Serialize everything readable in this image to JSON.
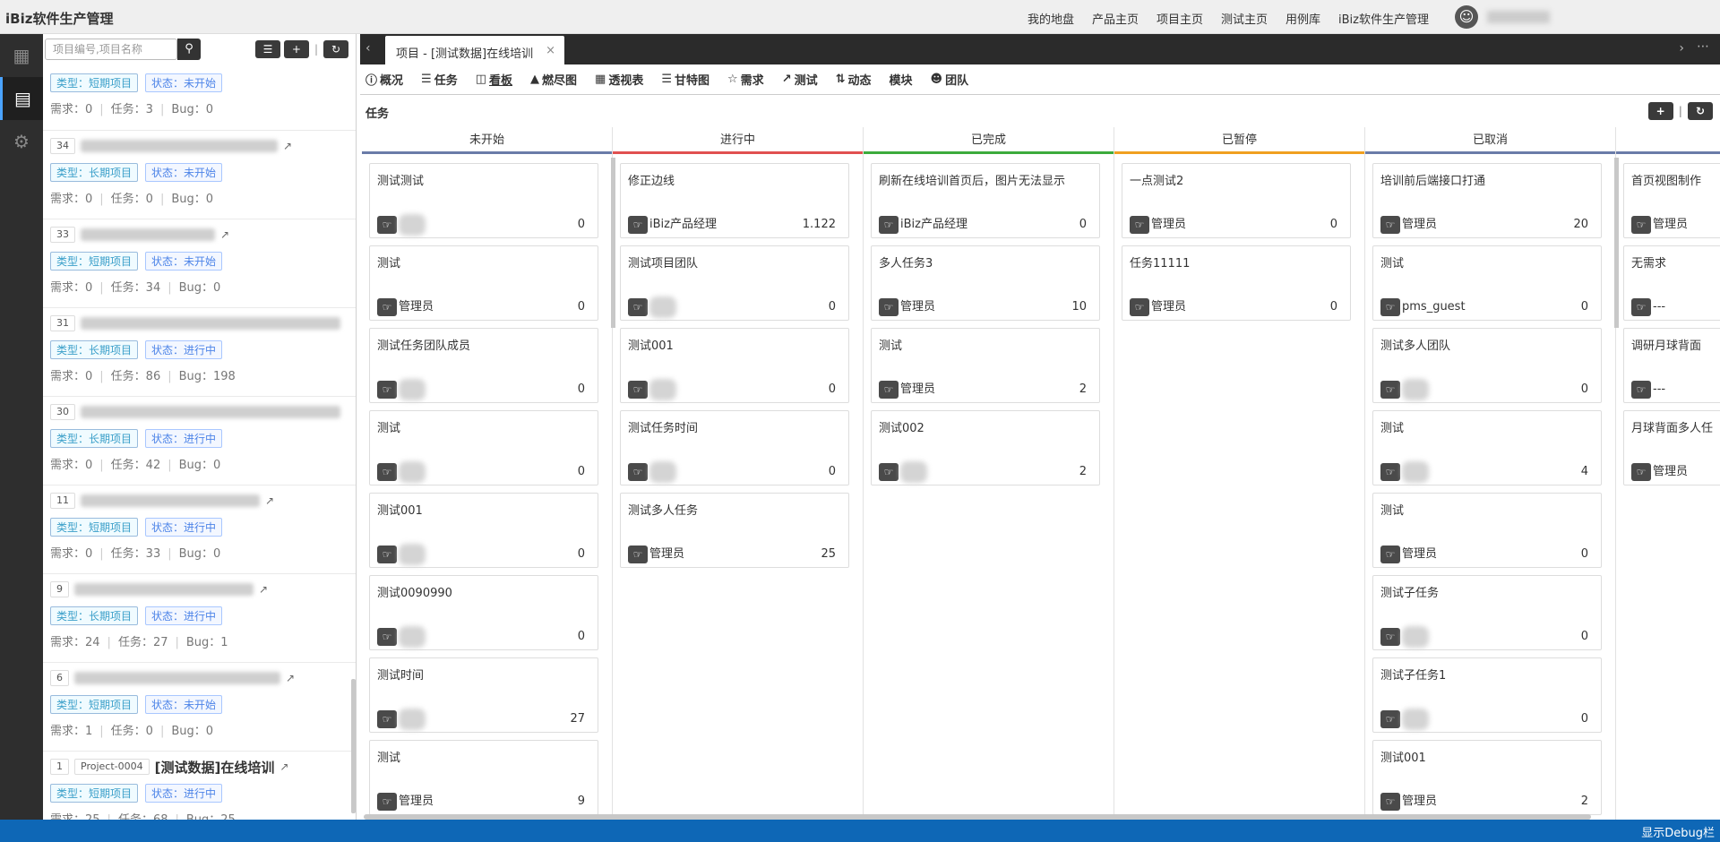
{
  "app": {
    "title": "iBiz软件生产管理"
  },
  "topnav": [
    "我的地盘",
    "产品主页",
    "项目主页",
    "测试主页",
    "用例库",
    "iBiz软件生产管理"
  ],
  "search": {
    "placeholder": "项目编号,项目名称"
  },
  "projects": [
    {
      "num": "",
      "type": "类型：短期项目",
      "status": "状态：未开始",
      "req": "需求：0",
      "task": "任务：3",
      "bug": "Bug：0"
    },
    {
      "num": "34",
      "type": "类型：长期项目",
      "status": "状态：未开始",
      "req": "需求：0",
      "task": "任务：0",
      "bug": "Bug：0"
    },
    {
      "num": "33",
      "type": "类型：短期项目",
      "status": "状态：未开始",
      "req": "需求：0",
      "task": "任务：34",
      "bug": "Bug：0"
    },
    {
      "num": "31",
      "type": "类型：长期项目",
      "status": "状态：进行中",
      "req": "需求：0",
      "task": "任务：86",
      "bug": "Bug：198"
    },
    {
      "num": "30",
      "type": "类型：长期项目",
      "status": "状态：进行中",
      "req": "需求：0",
      "task": "任务：42",
      "bug": "Bug：0"
    },
    {
      "num": "11",
      "type": "类型：短期项目",
      "status": "状态：进行中",
      "req": "需求：0",
      "task": "任务：33",
      "bug": "Bug：0"
    },
    {
      "num": "9",
      "type": "类型：长期项目",
      "status": "状态：进行中",
      "req": "需求：24",
      "task": "任务：27",
      "bug": "Bug：1"
    },
    {
      "num": "6",
      "type": "类型：短期项目",
      "status": "状态：未开始",
      "req": "需求：1",
      "task": "任务：0",
      "bug": "Bug：0"
    },
    {
      "num": "1",
      "code": "Project-0004",
      "name": "[测试数据]在线培训",
      "type": "类型：短期项目",
      "status": "状态：进行中",
      "req": "需求：25",
      "task": "任务：68",
      "bug": "Bug：25"
    }
  ],
  "tab": {
    "label": "项目 - [测试数据]在线培训"
  },
  "toolbar": [
    "概况",
    "任务",
    "看板",
    "燃尽图",
    "透视表",
    "甘特图",
    "需求",
    "测试",
    "动态",
    "模块",
    "团队"
  ],
  "section": {
    "title": "任务"
  },
  "columns": [
    {
      "title": "未开始",
      "color": "#6a7ba8",
      "cards": [
        {
          "title": "测试测试",
          "user": "",
          "num": "0"
        },
        {
          "title": "测试",
          "user": "管理员",
          "num": "0"
        },
        {
          "title": "测试任务团队成员",
          "user": "",
          "num": "0"
        },
        {
          "title": "测试",
          "user": "",
          "num": "0"
        },
        {
          "title": "测试001",
          "user": "",
          "num": "0"
        },
        {
          "title": "测试0090990",
          "user": "",
          "num": "0"
        },
        {
          "title": "测试时间",
          "user": "",
          "num": "27"
        },
        {
          "title": "测试",
          "user": "管理员",
          "num": "9"
        }
      ]
    },
    {
      "title": "进行中",
      "color": "#e05050",
      "cards": [
        {
          "title": "修正边线",
          "user": "iBiz产品经理",
          "num": "1.122"
        },
        {
          "title": "测试项目团队",
          "user": "",
          "num": "0"
        },
        {
          "title": "测试001",
          "user": "",
          "num": "0"
        },
        {
          "title": "测试任务时间",
          "user": "",
          "num": "0"
        },
        {
          "title": "测试多人任务",
          "user": "管理员",
          "num": "25"
        }
      ]
    },
    {
      "title": "已完成",
      "color": "#3cab3c",
      "cards": [
        {
          "title": "刷新在线培训首页后，图片无法显示",
          "user": "iBiz产品经理",
          "num": "0"
        },
        {
          "title": "多人任务3",
          "user": "管理员",
          "num": "10"
        },
        {
          "title": "测试",
          "user": "管理员",
          "num": "2"
        },
        {
          "title": "测试002",
          "user": "",
          "num": "2"
        }
      ]
    },
    {
      "title": "已暂停",
      "color": "#f0a020",
      "cards": [
        {
          "title": "一点测试2",
          "user": "管理员",
          "num": "0"
        },
        {
          "title": "任务11111",
          "user": "管理员",
          "num": "0"
        }
      ]
    },
    {
      "title": "已取消",
      "color": "#6a7ba8",
      "cards": [
        {
          "title": "培训前后端接口打通",
          "user": "管理员",
          "num": "20"
        },
        {
          "title": "测试",
          "user": "pms_guest",
          "num": "0"
        },
        {
          "title": "测试多人团队",
          "user": "",
          "num": "0"
        },
        {
          "title": "测试",
          "user": "",
          "num": "4"
        },
        {
          "title": "测试",
          "user": "管理员",
          "num": "0"
        },
        {
          "title": "测试子任务",
          "user": "",
          "num": "0"
        },
        {
          "title": "测试子任务1",
          "user": "",
          "num": "0"
        },
        {
          "title": "测试001",
          "user": "管理员",
          "num": "2"
        }
      ]
    },
    {
      "title": "",
      "color": "#6a7ba8",
      "cards": [
        {
          "title": "首页视图制作",
          "user": "管理员",
          "num": ""
        },
        {
          "title": "无需求",
          "user": "---",
          "num": ""
        },
        {
          "title": "调研月球背面",
          "user": "---",
          "num": ""
        },
        {
          "title": "月球背面多人任",
          "user": "管理员",
          "num": ""
        }
      ]
    }
  ],
  "status": {
    "label": "显示Debug栏"
  }
}
